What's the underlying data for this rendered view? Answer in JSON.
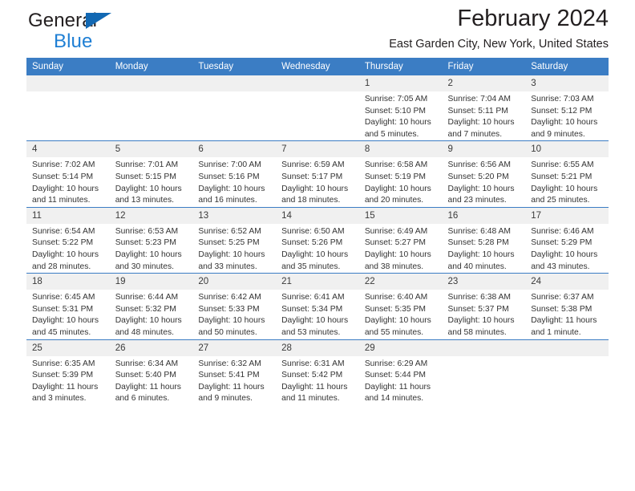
{
  "brand": {
    "line1": "General",
    "line2": "Blue",
    "triangle_color": "#1268b3",
    "blue_text_color": "#1f7fd4"
  },
  "header": {
    "title": "February 2024",
    "location": "East Garden City, New York, United States"
  },
  "theme": {
    "header_row_bg": "#3b7dc4",
    "header_row_text": "#ffffff",
    "daynum_bg": "#f0f0f0",
    "separator": "#3b7dc4",
    "cell_bg": "#ffffff"
  },
  "labels": {
    "sunrise_prefix": "Sunrise:",
    "sunset_prefix": "Sunset:",
    "daylight_prefix": "Daylight:"
  },
  "weekdays": [
    "Sunday",
    "Monday",
    "Tuesday",
    "Wednesday",
    "Thursday",
    "Friday",
    "Saturday"
  ],
  "weeks": [
    [
      {
        "day": "",
        "blank": true
      },
      {
        "day": "",
        "blank": true
      },
      {
        "day": "",
        "blank": true
      },
      {
        "day": "",
        "blank": true
      },
      {
        "day": "1",
        "sunrise": "Sunrise: 7:05 AM",
        "sunset": "Sunset: 5:10 PM",
        "daylight1": "Daylight: 10 hours",
        "daylight2": "and 5 minutes."
      },
      {
        "day": "2",
        "sunrise": "Sunrise: 7:04 AM",
        "sunset": "Sunset: 5:11 PM",
        "daylight1": "Daylight: 10 hours",
        "daylight2": "and 7 minutes."
      },
      {
        "day": "3",
        "sunrise": "Sunrise: 7:03 AM",
        "sunset": "Sunset: 5:12 PM",
        "daylight1": "Daylight: 10 hours",
        "daylight2": "and 9 minutes."
      }
    ],
    [
      {
        "day": "4",
        "sunrise": "Sunrise: 7:02 AM",
        "sunset": "Sunset: 5:14 PM",
        "daylight1": "Daylight: 10 hours",
        "daylight2": "and 11 minutes."
      },
      {
        "day": "5",
        "sunrise": "Sunrise: 7:01 AM",
        "sunset": "Sunset: 5:15 PM",
        "daylight1": "Daylight: 10 hours",
        "daylight2": "and 13 minutes."
      },
      {
        "day": "6",
        "sunrise": "Sunrise: 7:00 AM",
        "sunset": "Sunset: 5:16 PM",
        "daylight1": "Daylight: 10 hours",
        "daylight2": "and 16 minutes."
      },
      {
        "day": "7",
        "sunrise": "Sunrise: 6:59 AM",
        "sunset": "Sunset: 5:17 PM",
        "daylight1": "Daylight: 10 hours",
        "daylight2": "and 18 minutes."
      },
      {
        "day": "8",
        "sunrise": "Sunrise: 6:58 AM",
        "sunset": "Sunset: 5:19 PM",
        "daylight1": "Daylight: 10 hours",
        "daylight2": "and 20 minutes."
      },
      {
        "day": "9",
        "sunrise": "Sunrise: 6:56 AM",
        "sunset": "Sunset: 5:20 PM",
        "daylight1": "Daylight: 10 hours",
        "daylight2": "and 23 minutes."
      },
      {
        "day": "10",
        "sunrise": "Sunrise: 6:55 AM",
        "sunset": "Sunset: 5:21 PM",
        "daylight1": "Daylight: 10 hours",
        "daylight2": "and 25 minutes."
      }
    ],
    [
      {
        "day": "11",
        "sunrise": "Sunrise: 6:54 AM",
        "sunset": "Sunset: 5:22 PM",
        "daylight1": "Daylight: 10 hours",
        "daylight2": "and 28 minutes."
      },
      {
        "day": "12",
        "sunrise": "Sunrise: 6:53 AM",
        "sunset": "Sunset: 5:23 PM",
        "daylight1": "Daylight: 10 hours",
        "daylight2": "and 30 minutes."
      },
      {
        "day": "13",
        "sunrise": "Sunrise: 6:52 AM",
        "sunset": "Sunset: 5:25 PM",
        "daylight1": "Daylight: 10 hours",
        "daylight2": "and 33 minutes."
      },
      {
        "day": "14",
        "sunrise": "Sunrise: 6:50 AM",
        "sunset": "Sunset: 5:26 PM",
        "daylight1": "Daylight: 10 hours",
        "daylight2": "and 35 minutes."
      },
      {
        "day": "15",
        "sunrise": "Sunrise: 6:49 AM",
        "sunset": "Sunset: 5:27 PM",
        "daylight1": "Daylight: 10 hours",
        "daylight2": "and 38 minutes."
      },
      {
        "day": "16",
        "sunrise": "Sunrise: 6:48 AM",
        "sunset": "Sunset: 5:28 PM",
        "daylight1": "Daylight: 10 hours",
        "daylight2": "and 40 minutes."
      },
      {
        "day": "17",
        "sunrise": "Sunrise: 6:46 AM",
        "sunset": "Sunset: 5:29 PM",
        "daylight1": "Daylight: 10 hours",
        "daylight2": "and 43 minutes."
      }
    ],
    [
      {
        "day": "18",
        "sunrise": "Sunrise: 6:45 AM",
        "sunset": "Sunset: 5:31 PM",
        "daylight1": "Daylight: 10 hours",
        "daylight2": "and 45 minutes."
      },
      {
        "day": "19",
        "sunrise": "Sunrise: 6:44 AM",
        "sunset": "Sunset: 5:32 PM",
        "daylight1": "Daylight: 10 hours",
        "daylight2": "and 48 minutes."
      },
      {
        "day": "20",
        "sunrise": "Sunrise: 6:42 AM",
        "sunset": "Sunset: 5:33 PM",
        "daylight1": "Daylight: 10 hours",
        "daylight2": "and 50 minutes."
      },
      {
        "day": "21",
        "sunrise": "Sunrise: 6:41 AM",
        "sunset": "Sunset: 5:34 PM",
        "daylight1": "Daylight: 10 hours",
        "daylight2": "and 53 minutes."
      },
      {
        "day": "22",
        "sunrise": "Sunrise: 6:40 AM",
        "sunset": "Sunset: 5:35 PM",
        "daylight1": "Daylight: 10 hours",
        "daylight2": "and 55 minutes."
      },
      {
        "day": "23",
        "sunrise": "Sunrise: 6:38 AM",
        "sunset": "Sunset: 5:37 PM",
        "daylight1": "Daylight: 10 hours",
        "daylight2": "and 58 minutes."
      },
      {
        "day": "24",
        "sunrise": "Sunrise: 6:37 AM",
        "sunset": "Sunset: 5:38 PM",
        "daylight1": "Daylight: 11 hours",
        "daylight2": "and 1 minute."
      }
    ],
    [
      {
        "day": "25",
        "sunrise": "Sunrise: 6:35 AM",
        "sunset": "Sunset: 5:39 PM",
        "daylight1": "Daylight: 11 hours",
        "daylight2": "and 3 minutes."
      },
      {
        "day": "26",
        "sunrise": "Sunrise: 6:34 AM",
        "sunset": "Sunset: 5:40 PM",
        "daylight1": "Daylight: 11 hours",
        "daylight2": "and 6 minutes."
      },
      {
        "day": "27",
        "sunrise": "Sunrise: 6:32 AM",
        "sunset": "Sunset: 5:41 PM",
        "daylight1": "Daylight: 11 hours",
        "daylight2": "and 9 minutes."
      },
      {
        "day": "28",
        "sunrise": "Sunrise: 6:31 AM",
        "sunset": "Sunset: 5:42 PM",
        "daylight1": "Daylight: 11 hours",
        "daylight2": "and 11 minutes."
      },
      {
        "day": "29",
        "sunrise": "Sunrise: 6:29 AM",
        "sunset": "Sunset: 5:44 PM",
        "daylight1": "Daylight: 11 hours",
        "daylight2": "and 14 minutes."
      },
      {
        "day": "",
        "blank": true
      },
      {
        "day": "",
        "blank": true
      }
    ]
  ]
}
